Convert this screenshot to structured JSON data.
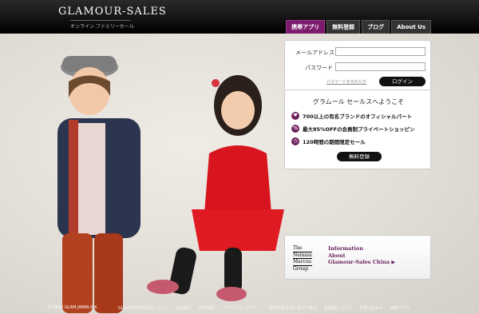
{
  "header": {
    "logo_text": "GLAMOUR-SALES",
    "logo_subtitle": "オンライン ファミリーセール",
    "nav": [
      {
        "label": "携帯アプリ"
      },
      {
        "label": "無料登録"
      },
      {
        "label": "ブログ"
      },
      {
        "label": "About Us"
      }
    ]
  },
  "login": {
    "email_label": "メールアドレス",
    "password_label": "パスワード",
    "forgot_link": "パスワードを忘れた方",
    "login_button": "ログイン"
  },
  "welcome": {
    "title": "グラムール セールスへようこそ",
    "features": [
      {
        "text": "700以上の有名ブランドのオフィシャルパート"
      },
      {
        "text": "最大85%OFFの会員制プライベートショッピン"
      },
      {
        "text": "120時間の期間限定セール"
      }
    ],
    "register_button": "無料登録"
  },
  "info": {
    "nm_logo": [
      "The",
      "Neiman",
      "Marcus",
      "Group"
    ],
    "line1": "Information",
    "line2": "About",
    "line3": "Glamour-Sales China ▶"
  },
  "footer": {
    "copyright": "© 2012 GLAM JAPAN K.K.",
    "links": [
      "GLAMOUR-SALESについて",
      "入社案内",
      "利用規約",
      "プライバシーポリシー",
      "特定商取引法に基づく表示",
      "返品等について",
      "お問い合わせ",
      "携帯アプリ"
    ]
  },
  "colors": {
    "accent": "#7c1a6b",
    "header_bg": "#111111"
  }
}
